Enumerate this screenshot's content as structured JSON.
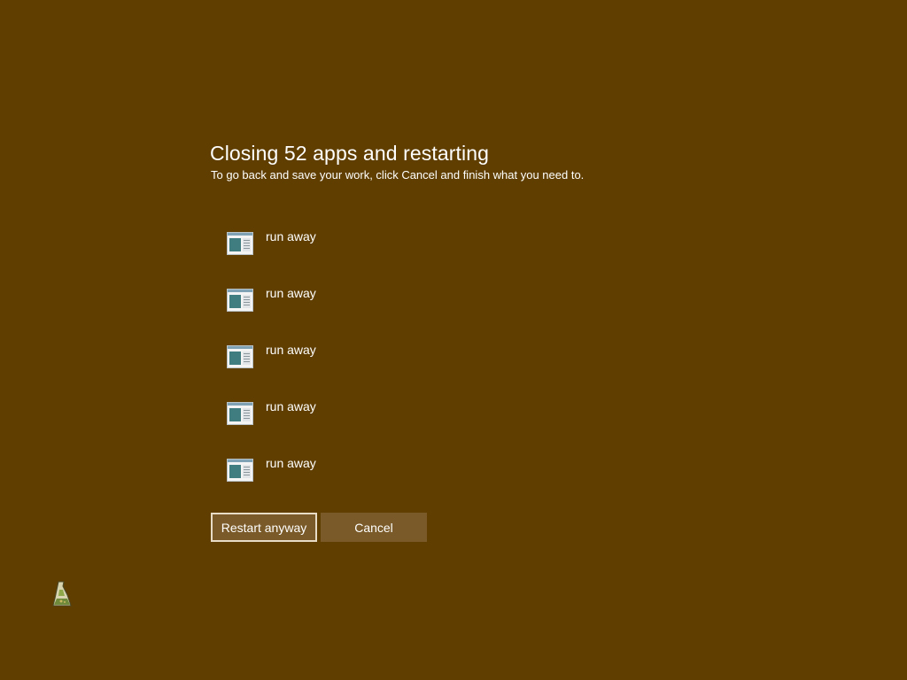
{
  "header": {
    "title": "Closing 52 apps and restarting",
    "subtitle": "To go back and save your work, click Cancel and finish what you need to."
  },
  "apps": [
    {
      "label": "run away",
      "icon": "application-window-icon"
    },
    {
      "label": "run away",
      "icon": "application-window-icon"
    },
    {
      "label": "run away",
      "icon": "application-window-icon"
    },
    {
      "label": "run away",
      "icon": "application-window-icon"
    },
    {
      "label": "run away",
      "icon": "application-window-icon"
    }
  ],
  "actions": {
    "restart_label": "Restart anyway",
    "cancel_label": "Cancel"
  },
  "cursor": {
    "icon": "busy-hourglass-cursor-icon"
  },
  "colors": {
    "background": "#5f3e00",
    "button_fill": "#7a5a28",
    "button_focus_border": "#e8dcc6",
    "text": "#ffffff"
  }
}
